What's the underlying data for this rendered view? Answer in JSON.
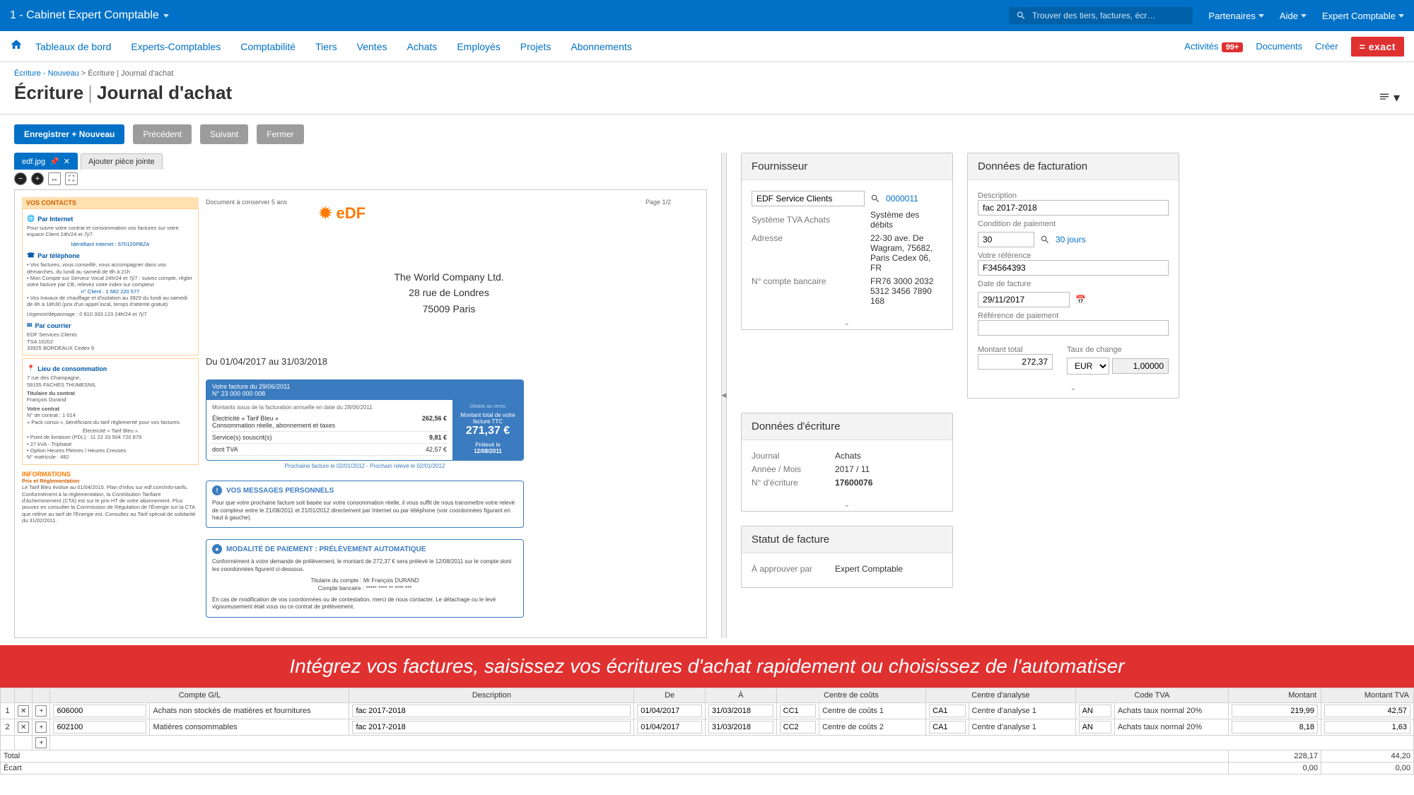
{
  "topbar": {
    "company": "1 - Cabinet Expert Comptable",
    "search_placeholder": "Trouver des tiers, factures, écr…",
    "links": {
      "partners": "Partenaires",
      "help": "Aide",
      "user": "Expert Comptable"
    }
  },
  "nav": {
    "items": [
      "Tableaux de bord",
      "Experts-Comptables",
      "Comptabilité",
      "Tiers",
      "Ventes",
      "Achats",
      "Employés",
      "Projets",
      "Abonnements"
    ],
    "right": {
      "activities": "Activités",
      "badge": "99+",
      "documents": "Documents",
      "create": "Créer",
      "brand": "= exact"
    }
  },
  "breadcrumb": {
    "l1": "Écriture - Nouveau",
    "sep": ">",
    "l2": "Écriture | Journal d'achat"
  },
  "title": {
    "t1": "Écriture",
    "t2": "Journal d'achat"
  },
  "actions": {
    "save": "Enregistrer + Nouveau",
    "prev": "Précédent",
    "next": "Suivant",
    "close": "Fermer"
  },
  "tabs": {
    "active": "edf.jpg",
    "add": "Ajouter pièce jointe"
  },
  "doc": {
    "keep": "Document à conserver 5 ans",
    "page": "Page 1/2",
    "addr1": "The World Company Ltd.",
    "addr2": "28 rue de Londres",
    "addr3": "75009 Paris",
    "period": "Du 01/04/2017 au 31/03/2018",
    "side": {
      "contacts": "VOS CONTACTS",
      "internet": "Par Internet",
      "internet_txt": "Pour suivre votre contrat et consommation vos factures sur votre espace Client 24h/24 et 7j/7",
      "internet_id": "Identifiant Internet : 670120PBZA",
      "phone": "Par téléphone",
      "phone_txt1": "• Vos factures, vous conseillé, vous accompagner dans vos démarches, du lundi au samedi de 8h à 21h",
      "phone_txt2": "• Mon Compte sur Serveur Vocal 24h/24 et 7j/7 : suivez compte, régler votre facture par CB, relevez votre index sur compteur",
      "phone_num": "n° Client : 1 582 220 577",
      "phone_txt3": "• Vos travaux de chauffage et d'isolation au 3929 du lundi au samedi de 8h à 18h30 (prix d'un appel local, temps d'attente gratuit)",
      "urgence": "Urgence/dépannage : 0 810 333 123 24h/24 et 7j/7",
      "courrier": "Par courrier",
      "courrier_txt": "EDF Services Clients\nTSA 10202\n33925 BORDEAUX Cedex 9",
      "lieu": "Lieu de consommation",
      "lieu_txt": "7 rue des Champagne,\n59155 FACHES THUMESNIL",
      "titulaire": "Titulaire du contrat",
      "titulaire_txt": "François Durand",
      "contrat": "Votre contrat",
      "contrat_txt": "N° de contrat : 1 014\n« Pack conso », bénéficiant du tarif réglementé pour vos factures",
      "elec": "Électricité « Tarif Bleu »",
      "elec_txt": "• Point de livraison (PDL) : 11 22 33 504 720 879\n• 27 kVA - Triphasé\n• Option Heures Pleines / Heures Creuses\nN° matricule : 482",
      "info": "INFORMATIONS",
      "info_h": "Prix et Réglementation",
      "info_txt": "Le Tarif Bleu évolue au 01/04/2015. Plan d'infos sur edf.com/info-tarifs. Conformément à la réglementation, la Contribution Tarifaire d'Acheminement (CTA) est sur le prix HT de votre abonnement. Plus pouvez en consulter la Commission de Régulation de l'Énergie sur la CTA que relève au tarif de l'Energie est. Consultez au Tarif spécial de solidarité du 31/02/2011."
    },
    "fact": {
      "head": "Votre facture du 29/06/2011\nN° 23 000 000 008",
      "sub": "Montants issus de la facturation annuelle en date du 28/06/2011",
      "l1": "Électricité « Tarif Bleu »\nConsommation réelle, abonnement et taxes",
      "v1": "262,56 €",
      "l2": "Service(s) souscrit(s)",
      "v2": "9,81 €",
      "l3": "dont TVA",
      "v3": "42,57 €",
      "total_lbl": "Montant total de votre facture TTC",
      "total_val": "271,37 €",
      "due_lbl": "Prélevé le",
      "due_date": "12/08/2011",
      "hist": "Prochaine facture le 02/01/2012 - Prochain relevé le 02/01/2012"
    },
    "msg": {
      "h": "VOS MESSAGES PERSONNELS",
      "b": "Pour que votre prochaine facture soit basée sur votre consommation réelle, il vous suffit de nous transmettre votre relevé de compteur entre le 21/08/2011 et 21/01/2012 directement par Internet ou par téléphone (voir coordonnées figurant en haut à gauche)."
    },
    "pay": {
      "h": "MODALITÉ DE PAIEMENT : PRÉLÈVEMENT AUTOMATIQUE",
      "b": "Conformément à votre demande de prélèvement, le montant de 272,37 € sera prélevé le 12/08/2011 sur le compte dont les coordonnées figurent ci-dessous.",
      "holder": "Titulaire du compte : Mr François DURAND",
      "bank": "Compte bancaire : ***** **** ** **** ***",
      "foot": "En cas de modification de vos coordonnées ou de contestation, merci de nous contacter. Le détachage ou le levé vigoureusement était vous ou ce contrat de prélèvement."
    }
  },
  "supplier": {
    "title": "Fournisseur",
    "name": "EDF Service Clients",
    "code": "0000011",
    "vat_lbl": "Système TVA Achats",
    "vat_val": "Système des débits",
    "addr_lbl": "Adresse",
    "addr_val": "22-30 ave. De Wagram, 75682, Paris Cedex 06, FR",
    "bank_lbl": "N° compte bancaire",
    "bank_val": "FR76 3000 2032 5312 3456 7890 168"
  },
  "billing": {
    "title": "Données de facturation",
    "desc_lbl": "Description",
    "desc_val": "fac 2017-2018",
    "cond_lbl": "Condition de paiement",
    "cond_val": "30",
    "cond_link": "30 jours",
    "ref_lbl": "Votre référence",
    "ref_val": "F34564393",
    "date_lbl": "Date de facture",
    "date_val": "29/11/2017",
    "payref_lbl": "Référence de paiement",
    "payref_val": "",
    "total_lbl": "Montant total",
    "total_val": "272,37",
    "rate_lbl": "Taux de change",
    "rate_cur": "EUR",
    "rate_val": "1,00000"
  },
  "entry": {
    "title": "Données d'écriture",
    "journal_lbl": "Journal",
    "journal_val": "Achats",
    "period_lbl": "Année / Mois",
    "period_val": "2017 / 11",
    "num_lbl": "N° d'écriture",
    "num_val": "17600076"
  },
  "status": {
    "title": "Statut de facture",
    "approve_lbl": "À approuver par",
    "approve_val": "Expert Comptable"
  },
  "banner": "Intégrez vos factures, saisissez vos écritures d'achat rapidement ou choisissez de l'automatiser",
  "grid": {
    "headers": {
      "gl": "Compte G/L",
      "desc": "Description",
      "from": "De",
      "to": "À",
      "cc": "Centre de coûts",
      "ca": "Centre d'analyse",
      "tva": "Code TVA",
      "amount": "Montant",
      "amount_tva": "Montant TVA"
    },
    "rows": [
      {
        "n": "1",
        "gl": "606000",
        "gl_name": "Achats non stockés de matières et fournitures",
        "desc": "fac 2017-2018",
        "from": "01/04/2017",
        "to": "31/03/2018",
        "cc": "CC1",
        "cc_name": "Centre de coûts 1",
        "ca": "CA1",
        "ca_name": "Centre d'analyse 1",
        "tva": "AN",
        "tva_name": "Achats taux normal 20%",
        "amount": "219,99",
        "amount_tva": "42,57"
      },
      {
        "n": "2",
        "gl": "602100",
        "gl_name": "Matières consommables",
        "desc": "fac 2017-2018",
        "from": "01/04/2017",
        "to": "31/03/2018",
        "cc": "CC2",
        "cc_name": "Centre de coûts 2",
        "ca": "CA1",
        "ca_name": "Centre d'analyse 1",
        "tva": "AN",
        "tva_name": "Achats taux normal 20%",
        "amount": "8,18",
        "amount_tva": "1,63"
      }
    ],
    "total_lbl": "Total",
    "total_amount": "228,17",
    "total_tva": "44,20",
    "gap_lbl": "Écart",
    "gap_amount": "0,00",
    "gap_tva": "0,00"
  }
}
